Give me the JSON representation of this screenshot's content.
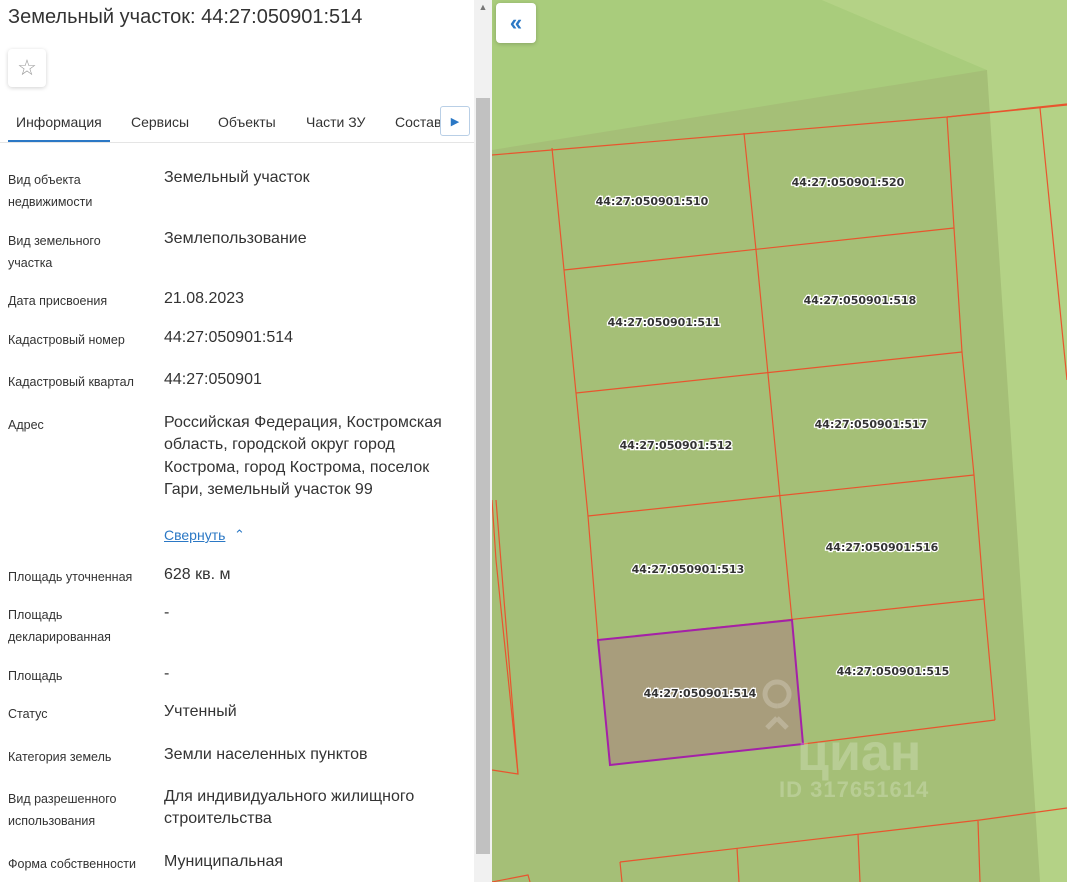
{
  "header": {
    "title": "Земельный участок: 44:27:050901:514",
    "favorite_icon": "☆"
  },
  "tabs": [
    {
      "label": "Информация",
      "active": true
    },
    {
      "label": "Сервисы",
      "active": false
    },
    {
      "label": "Объекты",
      "active": false
    },
    {
      "label": "Части ЗУ",
      "active": false
    },
    {
      "label": "Состав",
      "active": false
    }
  ],
  "tabs_next_icon": "▶",
  "info": {
    "object_type": {
      "label": "Вид объекта недвижимости",
      "value": "Земельный участок"
    },
    "land_type": {
      "label": "Вид земельного участка",
      "value": "Землепользование"
    },
    "assign_date": {
      "label": "Дата присвоения",
      "value": "21.08.2023"
    },
    "cadastral_number": {
      "label": "Кадастровый номер",
      "value": "44:27:050901:514"
    },
    "cadastral_quarter": {
      "label": "Кадастровый квартал",
      "value": "44:27:050901"
    },
    "address": {
      "label": "Адрес",
      "value": "Российская Федерация, Костромская область, городской округ город Кострома, город Кострома, поселок Гари, земельный участок 99",
      "collapse_label": "Свернуть",
      "collapse_icon": "⌃"
    },
    "area_specified": {
      "label": "Площадь уточненная",
      "value": "628 кв. м"
    },
    "area_declared": {
      "label": "Площадь декларированная",
      "value": "-"
    },
    "area": {
      "label": "Площадь",
      "value": "-"
    },
    "status": {
      "label": "Статус",
      "value": "Учтенный"
    },
    "land_category": {
      "label": "Категория земель",
      "value": "Земли населенных пунктов"
    },
    "permitted_use": {
      "label": "Вид разрешенного использования",
      "value": "Для индивидуального жилищного строительства"
    },
    "ownership": {
      "label": "Форма собственности",
      "value": "Муниципальная"
    }
  },
  "map": {
    "collapse_button_icon": "«",
    "parcels": [
      "44:27:050901:510",
      "44:27:050901:520",
      "44:27:050901:511",
      "44:27:050901:518",
      "44:27:050901:512",
      "44:27:050901:517",
      "44:27:050901:513",
      "44:27:050901:516",
      "44:27:050901:514",
      "44:27:050901:515"
    ],
    "selected_parcel": "44:27:050901:514",
    "watermark": "циан",
    "watermark_id": "ID 317651614",
    "colors": {
      "boundary": "#e8552e",
      "selected_boundary": "#a421a8",
      "land": "#a5bf77",
      "light_land": "#bfe08f"
    }
  }
}
